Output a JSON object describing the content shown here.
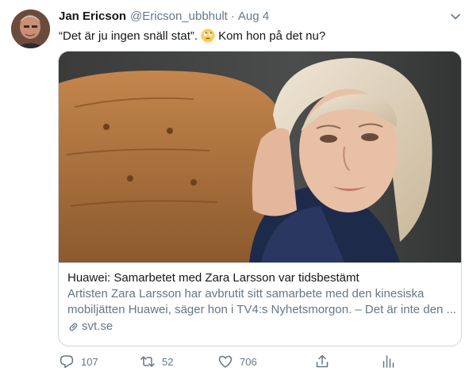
{
  "tweet": {
    "author_name": "Jan Ericson",
    "handle": "@Ericson_ubbhult",
    "separator": "·",
    "date": "Aug 4",
    "text_before_emoji": "“Det är ju ingen snäll stat”.",
    "emoji": "face-with-rolling-eyes",
    "text_after_emoji": "Kom hon på det nu?"
  },
  "card": {
    "title": "Huawei: Samarbetet med Zara Larsson var tidsbestämt",
    "description": "Artisten Zara Larsson har avbrutit sitt samarbete med den kinesiska mobiljätten Huawei, säger hon i TV4:s Nyhetsmorgon. – Det är inte den ...",
    "domain": "svt.se"
  },
  "actions": {
    "reply_count": "107",
    "retweet_count": "52",
    "like_count": "706"
  },
  "colors": {
    "text": "#14171a",
    "secondary": "#657786",
    "border": "#ccd6dd"
  }
}
